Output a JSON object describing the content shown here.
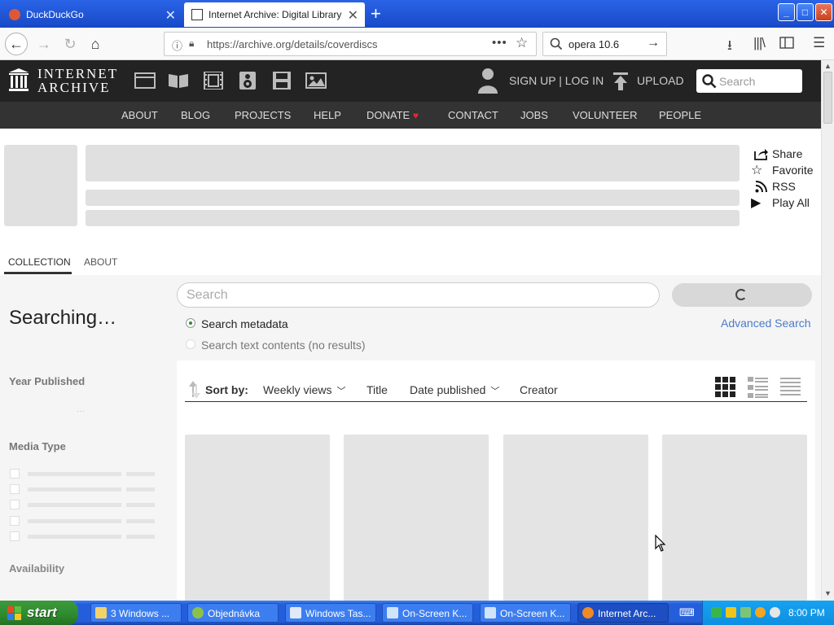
{
  "browser": {
    "tabs": [
      {
        "title": "DuckDuckGo"
      },
      {
        "title": "Internet Archive: Digital Library of"
      }
    ],
    "url": "https://archive.org/details/coverdiscs",
    "search_text": "opera 10.6"
  },
  "ia_header": {
    "logo_line1": "INTERNET",
    "logo_line2": "ARCHIVE",
    "signup_login": "SIGN UP | LOG IN",
    "upload": "UPLOAD",
    "search_placeholder": "Search",
    "subnav": [
      "ABOUT",
      "BLOG",
      "PROJECTS",
      "HELP",
      "DONATE",
      "CONTACT",
      "JOBS",
      "VOLUNTEER",
      "PEOPLE"
    ],
    "media_icons": [
      "web-icon",
      "texts-icon",
      "video-icon",
      "audio-icon",
      "software-icon",
      "images-icon"
    ]
  },
  "collection": {
    "actions": [
      {
        "label": "Share",
        "icon": "share-icon"
      },
      {
        "label": "Favorite",
        "icon": "star-icon"
      },
      {
        "label": "RSS",
        "icon": "rss-icon"
      },
      {
        "label": "Play All",
        "icon": "play-icon"
      }
    ],
    "tabs": [
      "COLLECTION",
      "ABOUT"
    ]
  },
  "search": {
    "placeholder": "Search",
    "options": [
      "Search metadata",
      "Search text contents (no results)"
    ],
    "advanced": "Advanced Search"
  },
  "sidebar": {
    "status": "Searching…",
    "facets": [
      "Year Published",
      "Media Type",
      "Availability"
    ],
    "year_placeholder": "···"
  },
  "sort": {
    "label": "Sort by:",
    "options": [
      "Weekly views",
      "Title",
      "Date published",
      "Creator"
    ]
  },
  "taskbar": {
    "start": "start",
    "tasks": [
      "3 Windows ...",
      "Objednávka",
      "Windows Tas...",
      "On-Screen K...",
      "On-Screen K...",
      "Internet Arc..."
    ],
    "time": "8:00 PM"
  },
  "colors": {
    "ia_dark": "#232323",
    "ia_subnav": "#333333",
    "link_blue": "#4b7bc6",
    "xp_blue": "#245edb",
    "xp_green": "#2f8a2f"
  }
}
